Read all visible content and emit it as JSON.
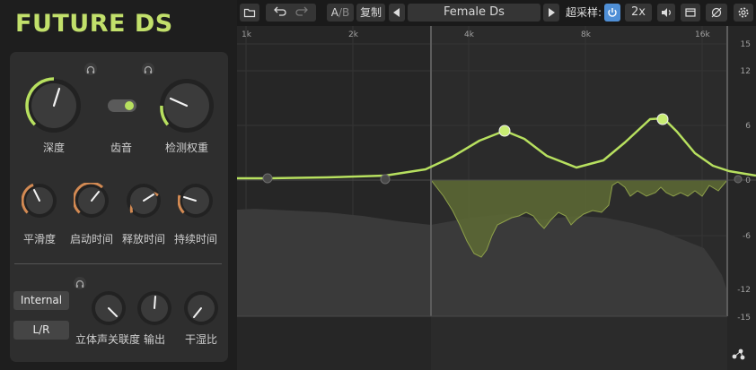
{
  "app": {
    "title": "FUTURE DS"
  },
  "left": {
    "knobs_top": [
      {
        "label": "深度"
      },
      {
        "label": "齿音"
      },
      {
        "label": "检测权重"
      }
    ],
    "knobs_mid": [
      {
        "label": "平滑度"
      },
      {
        "label": "启动时间"
      },
      {
        "label": "释放时间"
      },
      {
        "label": "持续时间"
      }
    ],
    "buttons": {
      "mode": "Internal",
      "channel": "L/R"
    },
    "knobs_bottom": [
      {
        "label": "立体声关联度"
      },
      {
        "label": "输出"
      },
      {
        "label": "干湿比"
      }
    ],
    "accent": "#b7e05f",
    "orange": "#d38a53"
  },
  "toolbar": {
    "ab_a": "A",
    "ab_sep": "/",
    "ab_b": "B",
    "copy": "复制",
    "preset": "Female Ds",
    "oversample_label": "超采样:",
    "oversample_value": "2x"
  },
  "graph": {
    "freq_labels": [
      "1k",
      "2k",
      "4k",
      "8k",
      "16k"
    ],
    "db_labels": [
      "15",
      "12",
      "6",
      "0",
      "-6",
      "-12",
      "-15"
    ]
  }
}
